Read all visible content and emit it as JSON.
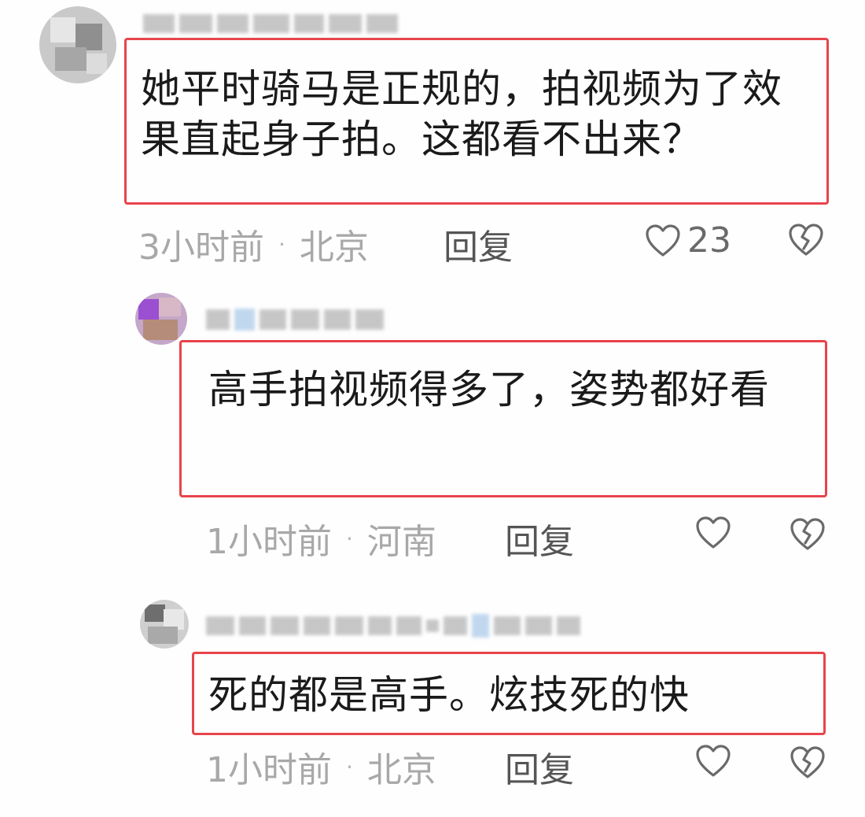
{
  "comments": [
    {
      "text": "她平时骑马是正规的，拍视频为了效果直起身子拍。这都看不出来？",
      "time": "3小时前",
      "location": "北京",
      "reply_label": "回复",
      "likes": "23"
    },
    {
      "text": "高手拍视频得多了，姿势都好看",
      "time": "1小时前",
      "location": "河南",
      "reply_label": "回复",
      "likes": ""
    },
    {
      "text": "死的都是高手。炫技死的快",
      "time": "1小时前",
      "location": "北京",
      "reply_label": "回复",
      "likes": ""
    }
  ],
  "colors": {
    "highlight_border": "#e8444b",
    "meta_text": "#a8a8a8",
    "body_text": "#1a1a1a"
  },
  "icons": {
    "like": "heart-outline-icon",
    "dislike": "broken-heart-icon"
  }
}
